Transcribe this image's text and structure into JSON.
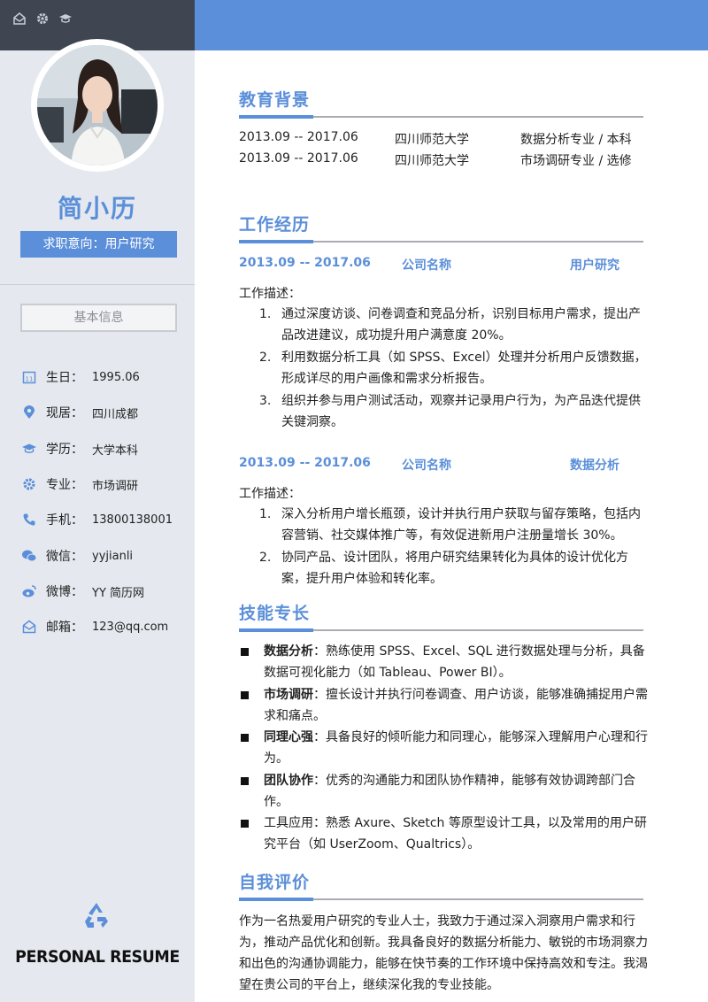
{
  "sidebar": {
    "top_icons": [
      "mail-icon",
      "gear-icon",
      "graduation-cap-icon"
    ],
    "name": "简小历",
    "intent": "求职意向：用户研究",
    "basic_info_label": "基本信息",
    "info": [
      {
        "icon": "calendar-icon",
        "label": "生日：",
        "value": "1995.06"
      },
      {
        "icon": "location-icon",
        "label": "现居：",
        "value": "四川成都"
      },
      {
        "icon": "graduation-cap-icon",
        "label": "学历：",
        "value": "大学本科"
      },
      {
        "icon": "gear-icon",
        "label": "专业：",
        "value": "市场调研"
      },
      {
        "icon": "phone-icon",
        "label": "手机：",
        "value": "13800138001"
      },
      {
        "icon": "wechat-icon",
        "label": "微信：",
        "value": "yyjianli"
      },
      {
        "icon": "weibo-icon",
        "label": "微博：",
        "value": "YY 简历网"
      },
      {
        "icon": "mail-icon",
        "label": "邮箱：",
        "value": "123@qq.com"
      }
    ],
    "footer_icon": "recycle-icon",
    "footer_title": "PERSONAL RESUME"
  },
  "education": {
    "title": "教育背景",
    "rows": [
      {
        "period": "2013.09 -- 2017.06",
        "school": "四川师范大学",
        "major": "数据分析专业 / 本科"
      },
      {
        "period": "2013.09 -- 2017.06",
        "school": "四川师范大学",
        "major": "市场调研专业 / 选修"
      }
    ]
  },
  "work": {
    "title": "工作经历",
    "jobs": [
      {
        "period": "2013.09 -- 2017.06",
        "company": "公司名称",
        "role": "用户研究",
        "desc_label": "工作描述：",
        "items": [
          {
            "num": "1.",
            "text": "通过深度访谈、问卷调查和竞品分析，识别目标用户需求，提出产品改进建议，成功提升用户满意度 20%。"
          },
          {
            "num": "2.",
            "text": "利用数据分析工具（如 SPSS、Excel）处理并分析用户反馈数据，形成详尽的用户画像和需求分析报告。"
          },
          {
            "num": "3.",
            "text": "组织并参与用户测试活动，观察并记录用户行为，为产品迭代提供关键洞察。"
          }
        ]
      },
      {
        "period": "2013.09 -- 2017.06",
        "company": "公司名称",
        "role": "数据分析",
        "desc_label": "工作描述：",
        "items": [
          {
            "num": "1.",
            "text": "深入分析用户增长瓶颈，设计并执行用户获取与留存策略，包括内容营销、社交媒体推广等，有效促进新用户注册量增长 30%。"
          },
          {
            "num": "2.",
            "text": "协同产品、设计团队，将用户研究结果转化为具体的设计优化方案，提升用户体验和转化率。"
          }
        ]
      }
    ]
  },
  "skills": {
    "title": "技能专长",
    "items": [
      {
        "name": "数据分析",
        "text": "：熟练使用 SPSS、Excel、SQL 进行数据处理与分析，具备数据可视化能力（如 Tableau、Power BI）。"
      },
      {
        "name": "市场调研",
        "text": "：擅长设计并执行问卷调查、用户访谈，能够准确捕捉用户需求和痛点。"
      },
      {
        "name": "同理心强",
        "text": "：具备良好的倾听能力和同理心，能够深入理解用户心理和行为。"
      },
      {
        "name": "团队协作",
        "text": "：优秀的沟通能力和团队协作精神，能够有效协调跨部门合作。"
      },
      {
        "name": "",
        "text": "工具应用：熟悉 Axure、Sketch 等原型设计工具，以及常用的用户研究平台（如 UserZoom、Qualtrics）。"
      }
    ]
  },
  "self_eval": {
    "title": "自我评价",
    "text": "作为一名热爱用户研究的专业人士，我致力于通过深入洞察用户需求和行为，推动产品优化和创新。我具备良好的数据分析能力、敏锐的市场洞察力和出色的沟通协调能力，能够在快节奏的工作环境中保持高效和专注。我渴望在贵公司的平台上，继续深化我的专业技能。"
  },
  "colors": {
    "accent": "#5b8fd9",
    "sidebar_bg": "#e5e9ef",
    "sidebar_top": "#3f4651"
  }
}
